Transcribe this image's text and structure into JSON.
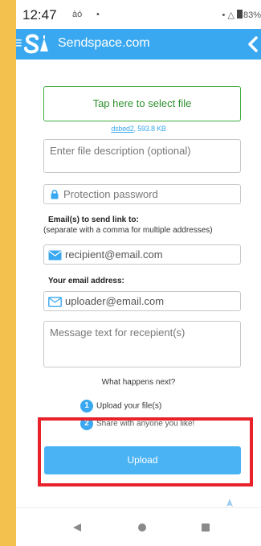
{
  "status_bar": {
    "time": "12:47",
    "extra_icons": "àó",
    "dot": "•",
    "right_indicators": "•  △",
    "battery": "83%"
  },
  "app_bar": {
    "title": "Sendspace.com",
    "logo_icon": "sendspace-logo-icon",
    "menu_icon": "hamburger-icon",
    "back_icon": "chevron-left-icon"
  },
  "form": {
    "select_file_label": "Tap here to select file",
    "file_name": "dsbed2",
    "file_size": ", 593.8 KB",
    "description_placeholder": "Enter file description (optional)",
    "password_placeholder": "Protection password",
    "recipient_label": "Email(s) to send link to:",
    "recipient_hint": "(separate with a comma for multiple addresses)",
    "recipient_value": "recipient@email.com",
    "sender_label": "Your email address:",
    "sender_value": "uploader@email.com",
    "message_placeholder": "Message text for recepient(s)"
  },
  "next_steps": {
    "heading": "What happens next?",
    "steps": [
      {
        "number": "1",
        "text": "Upload your file(s)"
      },
      {
        "number": "2",
        "text": "Share with anyone you like!"
      }
    ]
  },
  "upload_button": {
    "label": "Upload"
  },
  "colors": {
    "accent": "#3aa8f0",
    "select_border": "#3fae3f",
    "highlight": "#e8212a",
    "background_frame": "#f2c14e"
  }
}
